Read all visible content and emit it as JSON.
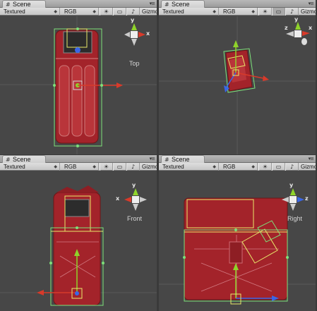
{
  "panes": [
    {
      "tab_label": "Scene",
      "mode_label": "Textured",
      "channel_label": "RGB",
      "gizmos_label": "Gizmos",
      "view_label": "Top",
      "axes": {
        "top": "y",
        "right": "x"
      }
    },
    {
      "tab_label": "Scene",
      "mode_label": "Textured",
      "channel_label": "RGB",
      "gizmos_label": "Gizmos",
      "view_label": "",
      "axes": {
        "top": "y",
        "left": "z",
        "right": "x"
      }
    },
    {
      "tab_label": "Scene",
      "mode_label": "Textured",
      "channel_label": "RGB",
      "gizmos_label": "Gizmos",
      "view_label": "Front",
      "axes": {
        "top": "y",
        "left": "x"
      }
    },
    {
      "tab_label": "Scene",
      "mode_label": "Textured",
      "channel_label": "RGB",
      "gizmos_label": "Gizmos",
      "view_label": "Right",
      "axes": {
        "top": "y",
        "right": "z"
      }
    }
  ],
  "icons": {
    "tab": "scene-grid-icon",
    "light": "lighting-toggle-icon",
    "image": "image-effects-icon",
    "sound": "audio-toggle-icon",
    "window": "pane-menu-icon"
  },
  "colors": {
    "axis_x": "#d83a2a",
    "axis_y": "#8fd32a",
    "axis_z": "#3a66e6",
    "bounds": "#7ee07a",
    "handle": "#e8e86a",
    "mesh": "#b8262a"
  }
}
